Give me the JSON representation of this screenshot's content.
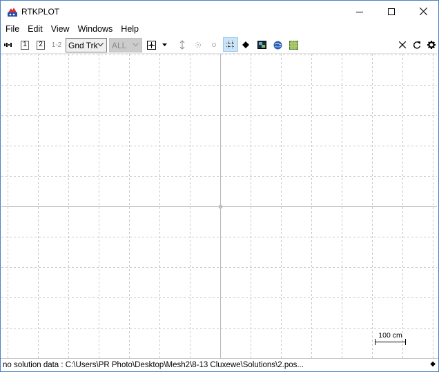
{
  "window": {
    "title": "RTKPLOT",
    "app_icon": "rtkplot-satellite-icon",
    "controls": [
      "minimize-icon",
      "maximize-icon",
      "close-icon"
    ]
  },
  "menu": [
    "File",
    "Edit",
    "View",
    "Windows",
    "Help"
  ],
  "toolbar": {
    "solution_1": "1",
    "solution_2": "2",
    "solution_12": "1-2",
    "plot_type": "Gnd Trk",
    "satellite_filter": "ALL",
    "icons": [
      "connect-icon",
      "center-origin-icon",
      "dropdown-arrow-icon",
      "fit-vertical-icon",
      "fit-horizontal-icon",
      "show-point-icon",
      "grid-icon",
      "point-marker-icon",
      "image-icon",
      "globe-icon",
      "map-icon",
      "clear-icon",
      "reload-icon",
      "settings-icon"
    ]
  },
  "plot": {
    "scale_label": "100 cm",
    "grid": true,
    "grid_color": "#c8c8c8",
    "axis_color": "#b4b4b4"
  },
  "status": {
    "message": "no solution data : C:\\Users\\PR Photo\\Desktop\\Mesh2\\8-13 Cluxewe\\Solutions\\2.pos...",
    "grip": "◆"
  }
}
